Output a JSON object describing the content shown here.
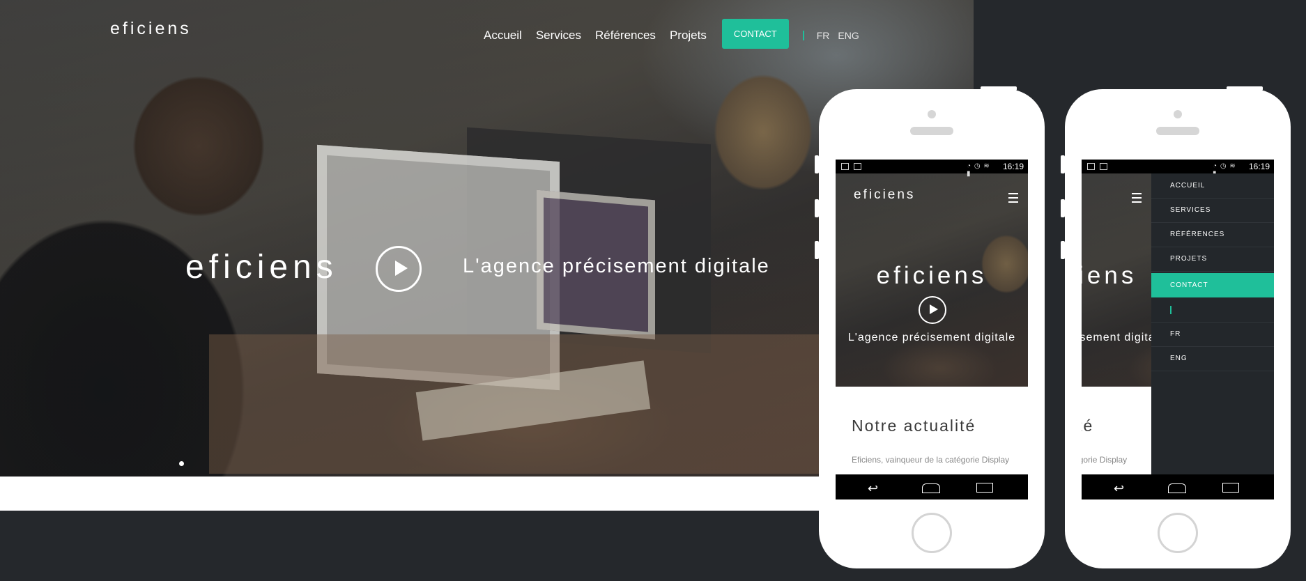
{
  "desktop": {
    "logo": "eficiens",
    "nav": [
      "Accueil",
      "Services",
      "Références",
      "Projets"
    ],
    "contact": "CONTACT",
    "lang": [
      "FR",
      "ENG"
    ],
    "hero_logo": "eficiens",
    "tagline": "L'agence précisement digitale"
  },
  "mobile": {
    "time": "16:19",
    "logo": "eficiens",
    "hero_logo": "eficiens",
    "tagline": "L'agence précisement digitale",
    "news_title": "Notre actualité",
    "article": "Eficiens, vainqueur de la catégorie Display"
  },
  "drawer": {
    "items": [
      "ACCUEIL",
      "SERVICES",
      "RÉFÉRENCES",
      "PROJETS"
    ],
    "contact": "CONTACT",
    "lang": [
      "FR",
      "ENG"
    ]
  },
  "colors": {
    "accent": "#1fbf9a",
    "background": "#25282c",
    "drawer": "#23272b"
  }
}
